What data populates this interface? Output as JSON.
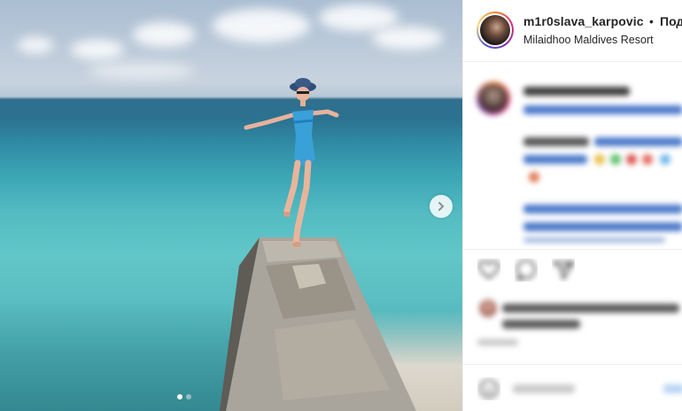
{
  "post": {
    "username": "m1r0slava_karpovic",
    "separator": "•",
    "follow_label": "Под",
    "location": "Milaidhoo Maldives Resort"
  },
  "carousel": {
    "total_slides": 2,
    "active_slide": 1
  },
  "icons": {
    "next": "chevron-right-icon",
    "like": "heart-icon",
    "comment": "speech-bubble-icon",
    "share": "paper-plane-icon",
    "emoji": "smiley-icon"
  },
  "colors": {
    "text": "#262626",
    "link": "#4a78c9",
    "divider": "#efefef"
  }
}
